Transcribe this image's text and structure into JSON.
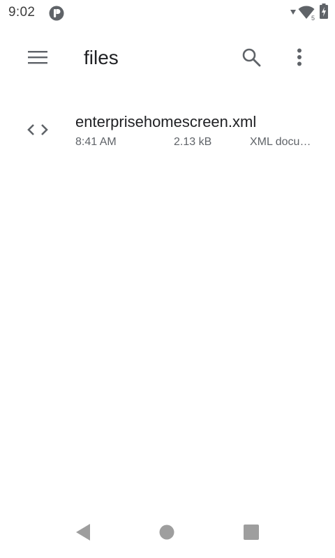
{
  "status_bar": {
    "time": "9:02",
    "app_icon": "notification-app-icon",
    "icons": [
      "signal-icon",
      "wifi-icon",
      "battery-charging-icon"
    ],
    "wifi_badge": "5"
  },
  "app_bar": {
    "title": "files",
    "menu_icon": "hamburger-menu-icon",
    "search_icon": "search-icon",
    "overflow_icon": "more-vert-icon"
  },
  "files": [
    {
      "name": "enterprisehomescreen.xml",
      "date": "8:41 AM",
      "size": "2.13 kB",
      "kind": "XML docu…",
      "icon": "code-icon"
    }
  ],
  "nav_bar": {
    "back_icon": "back-triangle-icon",
    "home_icon": "home-circle-icon",
    "recents_icon": "recents-square-icon"
  },
  "colors": {
    "icon_gray": "#5f6368",
    "text_primary": "#202124",
    "text_secondary": "#5f6368",
    "nav_gray": "#9e9e9e",
    "background": "#ffffff"
  }
}
